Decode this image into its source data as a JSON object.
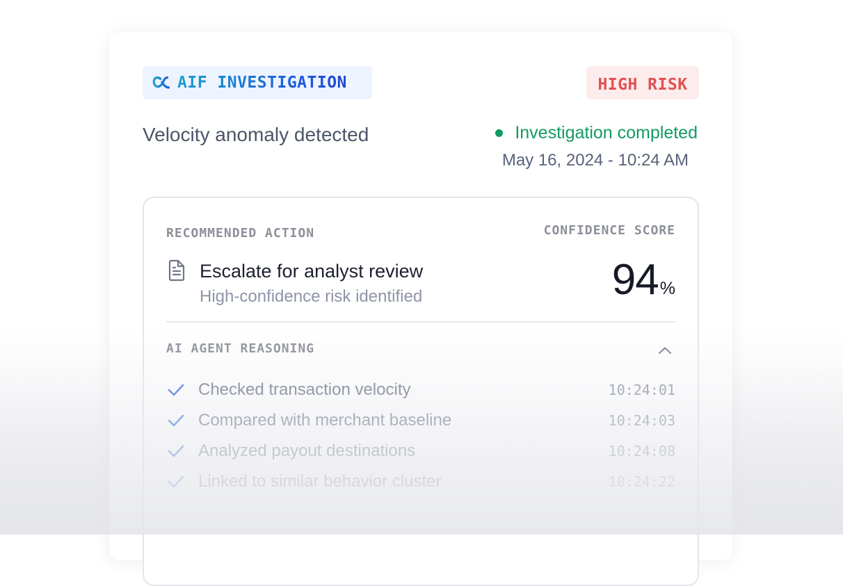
{
  "header": {
    "tag_label": "AIF INVESTIGATION",
    "tag_icon": "aif-logo-icon",
    "risk_label": "HIGH RISK",
    "risk_color": "#e25050"
  },
  "summary": {
    "title": "Velocity anomaly detected",
    "status": "Investigation completed",
    "status_color": "#129a63",
    "timestamp": "May 16, 2024 - 10:24 AM"
  },
  "recommendation": {
    "heading": "RECOMMENDED ACTION",
    "icon": "document-icon",
    "title": "Escalate for analyst review",
    "subtitle": "High-confidence risk identified"
  },
  "confidence": {
    "heading": "CONFIDENCE SCORE",
    "value": "94",
    "unit": "%"
  },
  "reasoning": {
    "heading": "AI AGENT REASONING",
    "expanded": true,
    "steps": [
      {
        "text": "Checked transaction velocity",
        "time": "10:24:01"
      },
      {
        "text": "Compared with merchant baseline",
        "time": "10:24:03"
      },
      {
        "text": "Analyzed payout destinations",
        "time": "10:24:08"
      },
      {
        "text": "Linked to similar behavior cluster",
        "time": "10:24:22"
      }
    ]
  },
  "colors": {
    "accent_blue": "#1b63db",
    "check_blue": "#3f72e0"
  }
}
